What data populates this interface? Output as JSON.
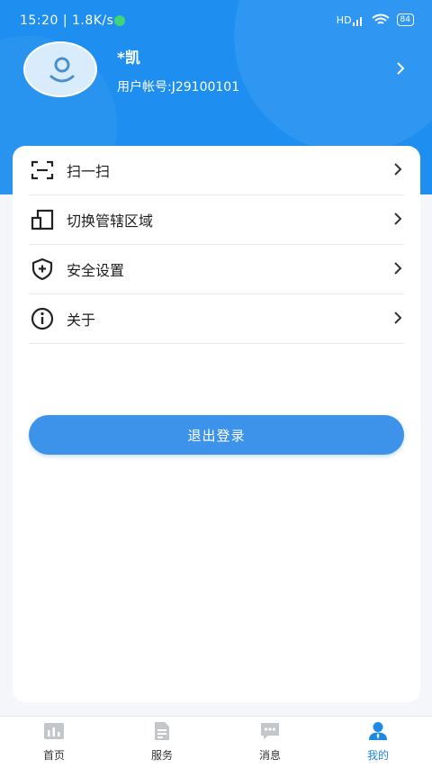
{
  "status_bar": {
    "time": "15:20",
    "network_speed": "1.8K/s",
    "signal_label": "HD",
    "battery": "84"
  },
  "profile": {
    "name": "*凯",
    "account": "用户帐号:J29100101"
  },
  "menu": {
    "items": [
      {
        "label": "扫一扫",
        "icon": "scan-icon"
      },
      {
        "label": "切换管辖区域",
        "icon": "switch-area-icon"
      },
      {
        "label": "安全设置",
        "icon": "shield-plus-icon"
      },
      {
        "label": "关于",
        "icon": "info-icon"
      }
    ]
  },
  "logout_label": "退出登录",
  "tabbar": {
    "items": [
      {
        "label": "首页",
        "icon": "home-chart-icon",
        "active": false
      },
      {
        "label": "服务",
        "icon": "document-icon",
        "active": false
      },
      {
        "label": "消息",
        "icon": "chat-icon",
        "active": false
      },
      {
        "label": "我的",
        "icon": "person-icon",
        "active": true
      }
    ]
  },
  "colors": {
    "header_blue": "#1e8ff0",
    "button_blue": "#3d93ea",
    "active_tab": "#1e88e5",
    "inactive_icon": "#c3c7cc"
  }
}
